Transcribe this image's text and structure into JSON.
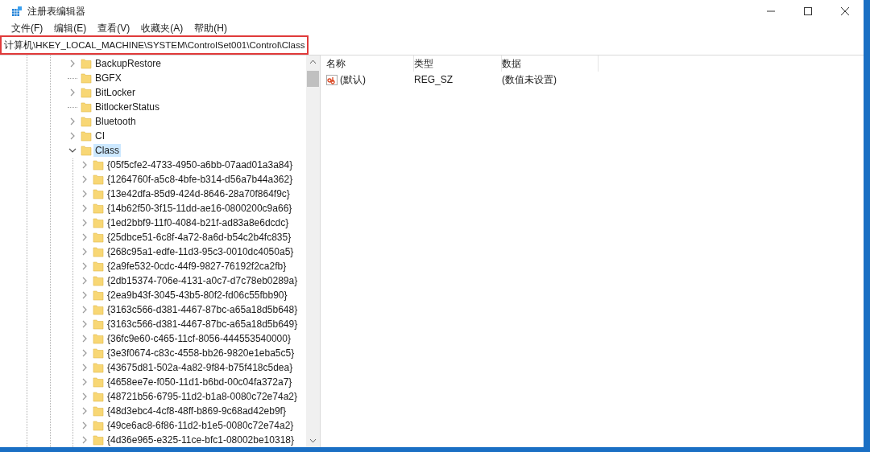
{
  "window": {
    "title": "注册表编辑器"
  },
  "menu": [
    "文件(F)",
    "编辑(E)",
    "查看(V)",
    "收藏夹(A)",
    "帮助(H)"
  ],
  "address_bar": {
    "value": "计算机\\HKEY_LOCAL_MACHINE\\SYSTEM\\ControlSet001\\Control\\Class",
    "highlighted": true
  },
  "tree": [
    {
      "name": "BackupRestore",
      "has_children": true,
      "expanded": false,
      "selected": false
    },
    {
      "name": "BGFX",
      "has_children": false,
      "selected": false
    },
    {
      "name": "BitLocker",
      "has_children": true,
      "expanded": false,
      "selected": false
    },
    {
      "name": "BitlockerStatus",
      "has_children": false,
      "selected": false
    },
    {
      "name": "Bluetooth",
      "has_children": true,
      "expanded": false,
      "selected": false
    },
    {
      "name": "CI",
      "has_children": true,
      "expanded": false,
      "selected": false
    },
    {
      "name": "Class",
      "has_children": true,
      "expanded": true,
      "selected": true,
      "children": [
        {
          "name": "{05f5cfe2-4733-4950-a6bb-07aad01a3a84}",
          "has_children": true,
          "expanded": false,
          "selected": false
        },
        {
          "name": "{1264760f-a5c8-4bfe-b314-d56a7b44a362}",
          "has_children": true,
          "expanded": false,
          "selected": false
        },
        {
          "name": "{13e42dfa-85d9-424d-8646-28a70f864f9c}",
          "has_children": true,
          "expanded": false,
          "selected": false
        },
        {
          "name": "{14b62f50-3f15-11dd-ae16-0800200c9a66}",
          "has_children": true,
          "expanded": false,
          "selected": false
        },
        {
          "name": "{1ed2bbf9-11f0-4084-b21f-ad83a8e6dcdc}",
          "has_children": true,
          "expanded": false,
          "selected": false
        },
        {
          "name": "{25dbce51-6c8f-4a72-8a6d-b54c2b4fc835}",
          "has_children": true,
          "expanded": false,
          "selected": false
        },
        {
          "name": "{268c95a1-edfe-11d3-95c3-0010dc4050a5}",
          "has_children": true,
          "expanded": false,
          "selected": false
        },
        {
          "name": "{2a9fe532-0cdc-44f9-9827-76192f2ca2fb}",
          "has_children": true,
          "expanded": false,
          "selected": false
        },
        {
          "name": "{2db15374-706e-4131-a0c7-d7c78eb0289a}",
          "has_children": true,
          "expanded": false,
          "selected": false
        },
        {
          "name": "{2ea9b43f-3045-43b5-80f2-fd06c55fbb90}",
          "has_children": true,
          "expanded": false,
          "selected": false
        },
        {
          "name": "{3163c566-d381-4467-87bc-a65a18d5b648}",
          "has_children": true,
          "expanded": false,
          "selected": false
        },
        {
          "name": "{3163c566-d381-4467-87bc-a65a18d5b649}",
          "has_children": true,
          "expanded": false,
          "selected": false
        },
        {
          "name": "{36fc9e60-c465-11cf-8056-444553540000}",
          "has_children": true,
          "expanded": false,
          "selected": false
        },
        {
          "name": "{3e3f0674-c83c-4558-bb26-9820e1eba5c5}",
          "has_children": true,
          "expanded": false,
          "selected": false
        },
        {
          "name": "{43675d81-502a-4a82-9f84-b75f418c5dea}",
          "has_children": true,
          "expanded": false,
          "selected": false
        },
        {
          "name": "{4658ee7e-f050-11d1-b6bd-00c04fa372a7}",
          "has_children": true,
          "expanded": false,
          "selected": false
        },
        {
          "name": "{48721b56-6795-11d2-b1a8-0080c72e74a2}",
          "has_children": true,
          "expanded": false,
          "selected": false
        },
        {
          "name": "{48d3ebc4-4cf8-48ff-b869-9c68ad42eb9f}",
          "has_children": true,
          "expanded": false,
          "selected": false
        },
        {
          "name": "{49ce6ac8-6f86-11d2-b1e5-0080c72e74a2}",
          "has_children": true,
          "expanded": false,
          "selected": false
        },
        {
          "name": "{4d36e965-e325-11ce-bfc1-08002be10318}",
          "has_children": true,
          "expanded": false,
          "selected": false
        }
      ]
    }
  ],
  "values_table": {
    "columns": [
      "名称",
      "类型",
      "数据"
    ],
    "rows": [
      {
        "kind": "string",
        "name": "(默认)",
        "type": "REG_SZ",
        "data": "(数值未设置)"
      }
    ]
  }
}
